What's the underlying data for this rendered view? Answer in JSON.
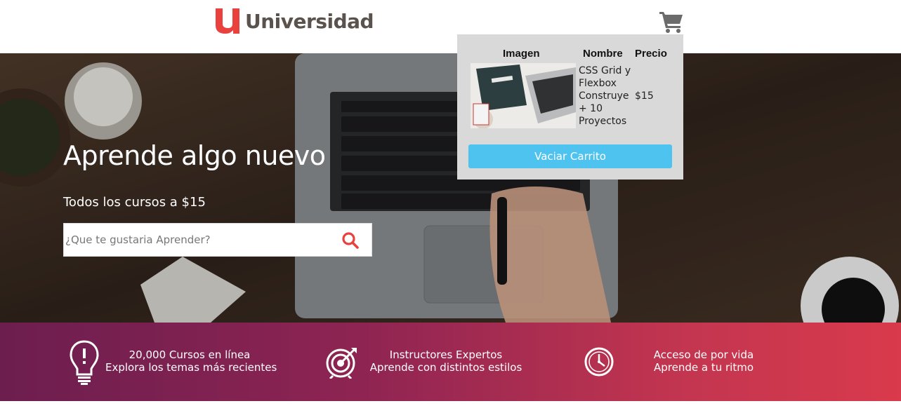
{
  "header": {
    "brand": "Universidad",
    "logo_letter": "u",
    "cart_icon": "shopping-cart-icon"
  },
  "hero": {
    "title": "Aprende algo nuevo",
    "subtitle": "Todos los cursos a $15",
    "search": {
      "placeholder": "¿Que te gustaria Aprender?",
      "value": "",
      "icon": "search-icon"
    }
  },
  "cart": {
    "headers": [
      "Imagen",
      "Nombre",
      "Precio"
    ],
    "items": [
      {
        "name": "CSS Grid y Flexbox Construye + 10 Proyectos",
        "price": "$15"
      }
    ],
    "empty_button": "Vaciar Carrito"
  },
  "benefits": [
    {
      "icon": "lightbulb-icon",
      "line1": "20,000 Cursos en línea",
      "line2": "Explora los temas más recientes"
    },
    {
      "icon": "target-icon",
      "line1": "Instructores Expertos",
      "line2": "Aprende con distintos estilos"
    },
    {
      "icon": "clock-icon",
      "line1": "Acceso de por vida",
      "line2": "Aprende a tu ritmo"
    }
  ],
  "colors": {
    "brand_red": "#e8413e",
    "brand_text": "#5a524c",
    "button_blue": "#4fc3ef",
    "bar_start": "#6c1e4f",
    "bar_end": "#d93a4c",
    "search_icon": "#e8413e"
  }
}
